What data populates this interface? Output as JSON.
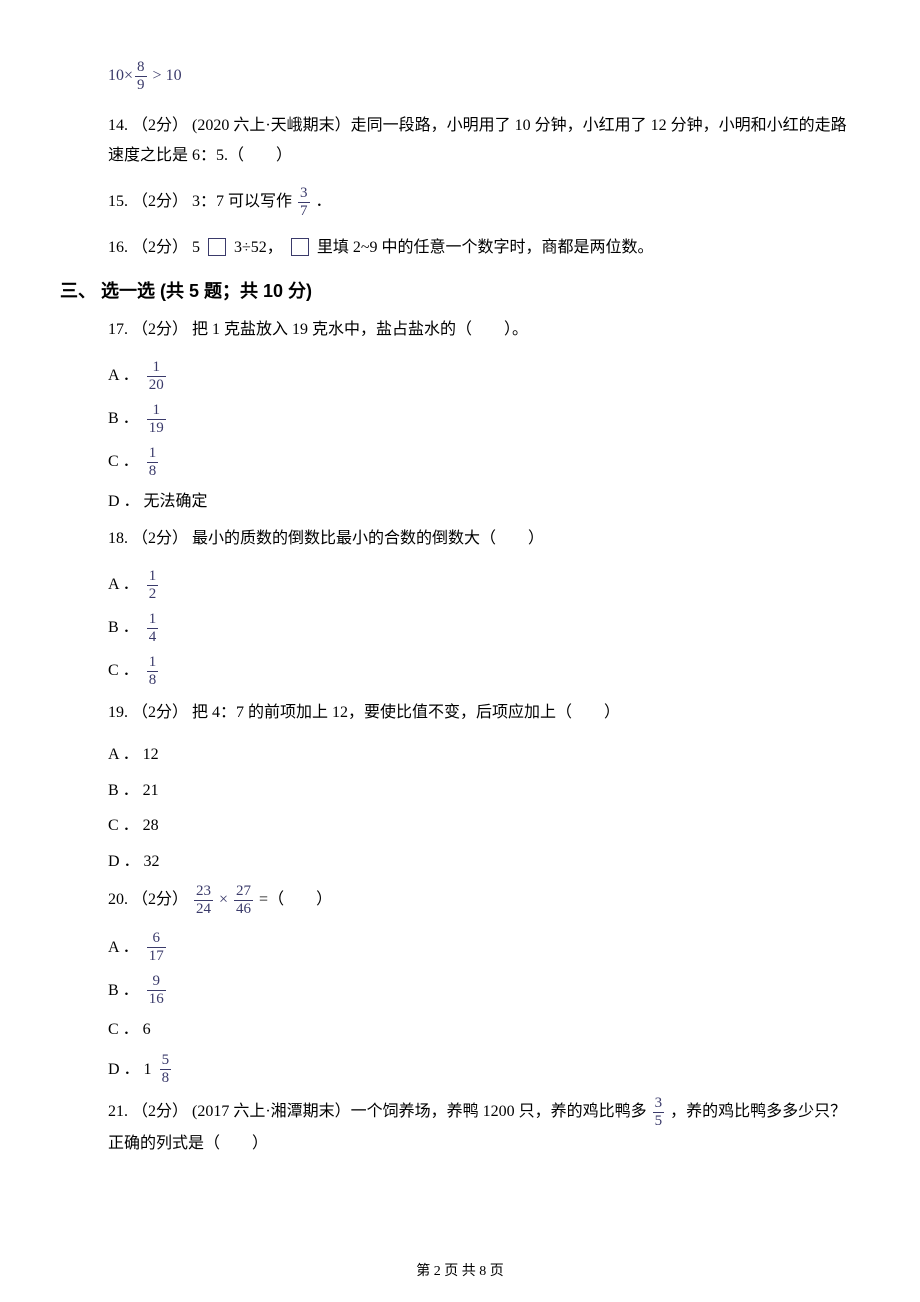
{
  "top_formula": {
    "lhs_mult": "10",
    "lhs_frac_num": "8",
    "lhs_frac_den": "9",
    "cmp": ">",
    "rhs": "10"
  },
  "q14": {
    "prefix": "14. （2分） (2020 六上·天峨期末）走同一段路，小明用了 10 分钟，小红用了 12 分钟，小明和小红的走路速度之比是 6：5.（　　）"
  },
  "q15": {
    "prefix": "15. （2分） 3：7 可以写作 ",
    "frac_num": "3",
    "frac_den": "7",
    "suffix": " ．"
  },
  "q16": {
    "prefix": "16. （2分） 5 ",
    "mid1": " 3÷52， ",
    "suffix": " 里填 2~9 中的任意一个数字时，商都是两位数。"
  },
  "section3": "三、 选一选 (共 5 题；共 10 分)",
  "q17": {
    "stem": "17. （2分） 把 1 克盐放入 19 克水中，盐占盐水的（　　）。",
    "opts": [
      {
        "label": "A ．",
        "frac_num": "1",
        "frac_den": "20"
      },
      {
        "label": "B ．",
        "frac_num": "1",
        "frac_den": "19"
      },
      {
        "label": "C ．",
        "frac_num": "1",
        "frac_den": "8"
      },
      {
        "label": "D ． 无法确定"
      }
    ]
  },
  "q18": {
    "stem": "18. （2分） 最小的质数的倒数比最小的合数的倒数大（　　）",
    "opts": [
      {
        "label": "A ．",
        "frac_num": "1",
        "frac_den": "2"
      },
      {
        "label": "B ．",
        "frac_num": "1",
        "frac_den": "4"
      },
      {
        "label": "C ．",
        "frac_num": "1",
        "frac_den": "8"
      }
    ]
  },
  "q19": {
    "stem": "19. （2分） 把 4：7 的前项加上 12，要使比值不变，后项应加上（　　）",
    "opts": [
      {
        "label": "A ． 12"
      },
      {
        "label": "B ． 21"
      },
      {
        "label": "C ． 28"
      },
      {
        "label": "D ． 32"
      }
    ]
  },
  "q20": {
    "stem_prefix": "20. （2分） ",
    "f1_num": "23",
    "f1_den": "24",
    "times": "×",
    "f2_num": "27",
    "f2_den": "46",
    "eq": " =（　　）",
    "opts": [
      {
        "label": "A ．",
        "frac_num": "6",
        "frac_den": "17"
      },
      {
        "label": "B ．",
        "frac_num": "9",
        "frac_den": "16"
      },
      {
        "label": "C ． 6"
      },
      {
        "label": "D ． 1 ",
        "frac_num": "5",
        "frac_den": "8"
      }
    ]
  },
  "q21": {
    "prefix": "21. （2分） (2017 六上·湘潭期末）一个饲养场，养鸭 1200 只，养的鸡比鸭多 ",
    "frac_num": "3",
    "frac_den": "5",
    "suffix": " ，养的鸡比鸭多多少只？正确的列式是（　　）"
  },
  "footer": "第 2 页 共 8 页"
}
